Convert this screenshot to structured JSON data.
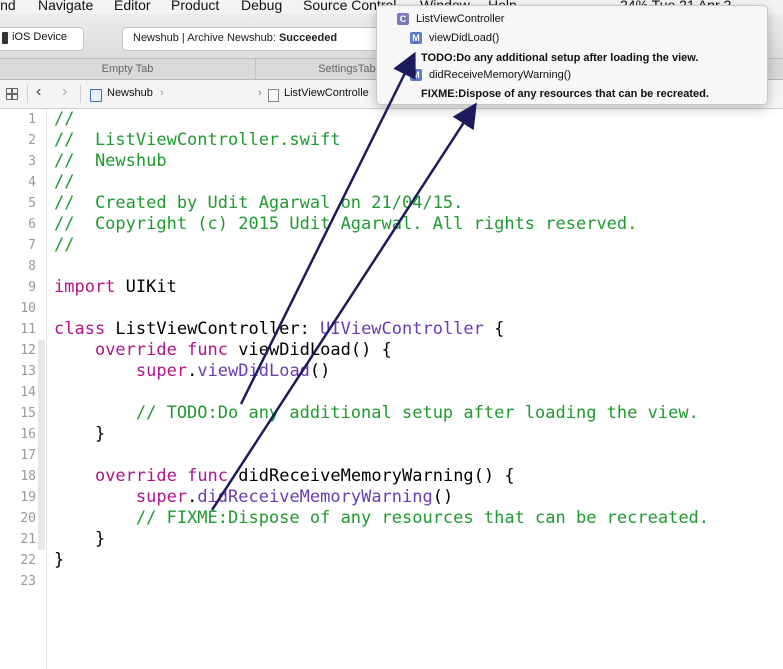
{
  "menu": {
    "items": [
      "ind",
      "Navigate",
      "Editor",
      "Product",
      "Debug",
      "Source Control",
      "Window",
      "Help"
    ],
    "status": "24%  Tue 21 Apr 2"
  },
  "toolbar": {
    "scheme_device": "iOS Device",
    "activity_project": "Newshub",
    "activity_label": "Archive Newshub:",
    "activity_status": "Succeeded"
  },
  "tabs": [
    "Empty Tab",
    "SettingsTableVi"
  ],
  "jumpbar": {
    "project": "Newshub",
    "file": "ListViewControlle"
  },
  "popover": {
    "class_badge": "C",
    "method_badge": "M",
    "items": [
      {
        "kind": "class",
        "label": "ListViewController"
      },
      {
        "kind": "method",
        "label": "viewDidLoad()"
      },
      {
        "kind": "mark",
        "label": "TODO:Do any additional setup after loading the view."
      },
      {
        "kind": "method",
        "label": "didReceiveMemoryWarning()"
      },
      {
        "kind": "mark",
        "label": "FIXME:Dispose of any resources that can be recreated."
      }
    ]
  },
  "editor": {
    "line_numbers": [
      "1",
      "2",
      "3",
      "4",
      "5",
      "6",
      "7",
      "8",
      "9",
      "10",
      "11",
      "12",
      "13",
      "14",
      "15",
      "16",
      "17",
      "18",
      "19",
      "20",
      "21",
      "22",
      "23"
    ],
    "lines": [
      {
        "t": "comment",
        "s": "//"
      },
      {
        "t": "comment",
        "s": "//  ListViewController.swift"
      },
      {
        "t": "comment",
        "s": "//  Newshub"
      },
      {
        "t": "comment",
        "s": "//"
      },
      {
        "t": "comment",
        "s": "//  Created by Udit Agarwal on 21/04/15."
      },
      {
        "t": "comment",
        "s": "//  Copyright (c) 2015 Udit Agarwal. All rights reserved."
      },
      {
        "t": "comment",
        "s": "//"
      },
      {
        "t": "blank",
        "s": ""
      },
      {
        "t": "import",
        "kw": "import",
        "rest": " UIKit"
      },
      {
        "t": "blank",
        "s": ""
      },
      {
        "t": "class",
        "kw": "class",
        "name": " ListViewController: ",
        "type": "UIViewController",
        "rest": " {"
      },
      {
        "t": "func",
        "indent": "    ",
        "kw1": "override",
        "kw2": " func",
        "rest": " viewDidLoad() {"
      },
      {
        "t": "call",
        "indent": "        ",
        "kw": "super",
        "dot": ".",
        "call": "viewDidLoad",
        "rest": "()"
      },
      {
        "t": "blank",
        "s": ""
      },
      {
        "t": "comment",
        "s": "        // TODO:Do any additional setup after loading the view."
      },
      {
        "t": "plain",
        "s": "    }"
      },
      {
        "t": "blank",
        "s": ""
      },
      {
        "t": "func",
        "indent": "    ",
        "kw1": "override",
        "kw2": " func",
        "rest": " didReceiveMemoryWarning() {"
      },
      {
        "t": "call",
        "indent": "        ",
        "kw": "super",
        "dot": ".",
        "call": "didReceiveMemoryWarning",
        "rest": "()"
      },
      {
        "t": "comment",
        "s": "        // FIXME:Dispose of any resources that can be recreated."
      },
      {
        "t": "plain",
        "s": "    }"
      },
      {
        "t": "plain",
        "s": "}"
      },
      {
        "t": "blank",
        "s": ""
      }
    ]
  },
  "colors": {
    "comment": "#1f9a2e",
    "keyword": "#b0138c",
    "type": "#6a3cb2",
    "arrow": "#1e1b5c"
  }
}
